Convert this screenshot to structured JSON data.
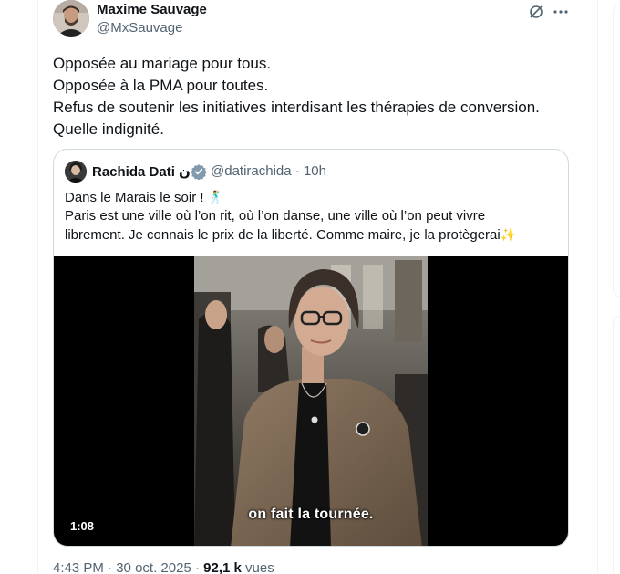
{
  "tweet": {
    "author_name": "Maxime Sauvage",
    "author_handle": "@MxSauvage",
    "lines": [
      "Opposée au mariage pour tous.",
      "Opposée à la PMA pour toutes.",
      "Refus de soutenir les initiatives interdisant les thérapies de conversion.",
      "Quelle indignité."
    ],
    "time": "4:43 PM",
    "separator": " · ",
    "date": "30 oct. 2025",
    "views": "92,1 k",
    "views_label": " vues"
  },
  "quote": {
    "author_name": "Rachida Dati ﻥ",
    "author_handle": "@datirachida",
    "separator": " · ",
    "time": "10h",
    "line1": "Dans le Marais le soir !",
    "line2": "Paris est une ville où l’on rit, où l’on  danse, une ville où l’on peut vivre",
    "line3": "librement. Je connais le prix de la liberté. Comme maire, je la protègerai",
    "emoji_dancer": "🕺",
    "emoji_sparkles": "✨"
  },
  "video": {
    "caption": "on fait la tournée.",
    "duration": "1:08"
  },
  "icons": {
    "grok": "grok-icon",
    "more": "more-icon",
    "verified": "verified-icon"
  },
  "colors": {
    "text": "#0f1419",
    "secondary": "#536471",
    "border": "#cfd9de",
    "verified_gray": "#829aab"
  }
}
